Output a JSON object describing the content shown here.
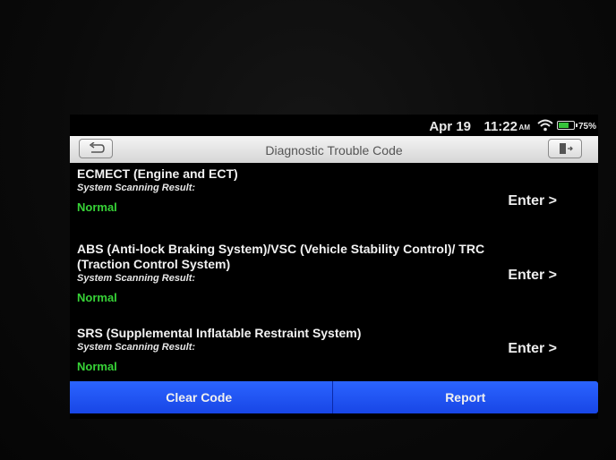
{
  "status_bar": {
    "date": "Apr 19",
    "time": "11:22",
    "ampm": "AM",
    "battery_percent": "75%",
    "battery_level": 0.75
  },
  "header": {
    "title": "Diagnostic Trouble Code",
    "back_icon": "back-arrow-icon",
    "exit_icon": "exit-door-icon"
  },
  "systems": [
    {
      "name": "ECMECT (Engine and ECT)",
      "label": "System Scanning Result:",
      "result": "Normal",
      "enter_label": "Enter >"
    },
    {
      "name": "ABS (Anti-lock Braking System)/VSC (Vehicle Stability Control)/ TRC (Traction Control System)",
      "label": "System Scanning Result:",
      "result": "Normal",
      "enter_label": "Enter >"
    },
    {
      "name": "SRS (Supplemental Inflatable Restraint System)",
      "label": "System Scanning Result:",
      "result": "Normal",
      "enter_label": "Enter >"
    }
  ],
  "footer": {
    "clear_code_label": "Clear Code",
    "report_label": "Report"
  },
  "colors": {
    "accent_blue": "#2157f2",
    "normal_green": "#37d237"
  }
}
